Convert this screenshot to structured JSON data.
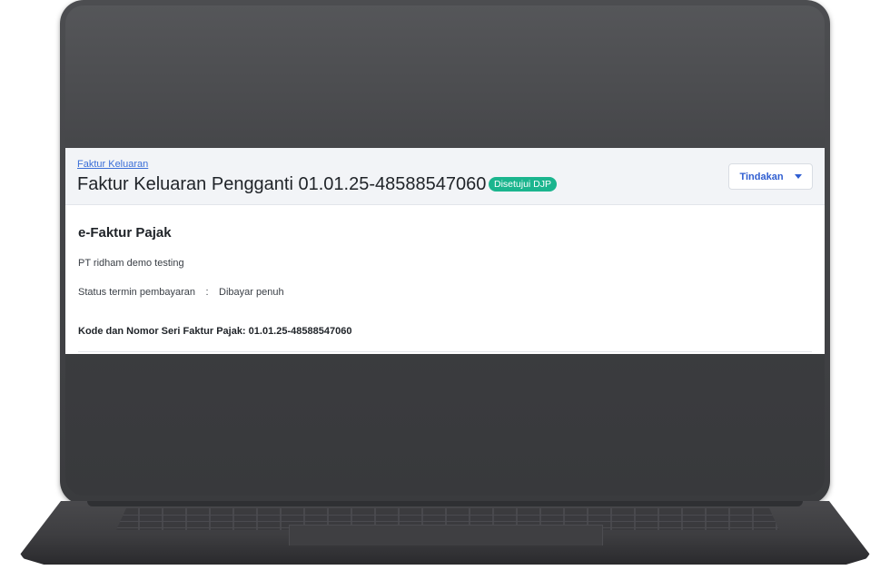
{
  "header": {
    "breadcrumb": "Faktur Keluaran",
    "title": "Faktur Keluaran Pengganti 01.01.25-48588547060",
    "status_badge": "Disetujui DJP",
    "action_button": "Tindakan"
  },
  "document": {
    "title": "e-Faktur Pajak",
    "company": "PT ridham demo testing",
    "term_label": "Status termin pembayaran",
    "term_separator": ":",
    "term_value": "Dibayar penuh",
    "serial": "Kode dan Nomor Seri Faktur Pajak: 01.01.25-48588547060"
  },
  "colors": {
    "accent": "#2f5ed1",
    "badge": "#1bb58e",
    "header_bg": "#f2f4f7",
    "laptop_body": "#3d3e41"
  },
  "icons": {
    "action_caret": "caret-down-icon"
  }
}
